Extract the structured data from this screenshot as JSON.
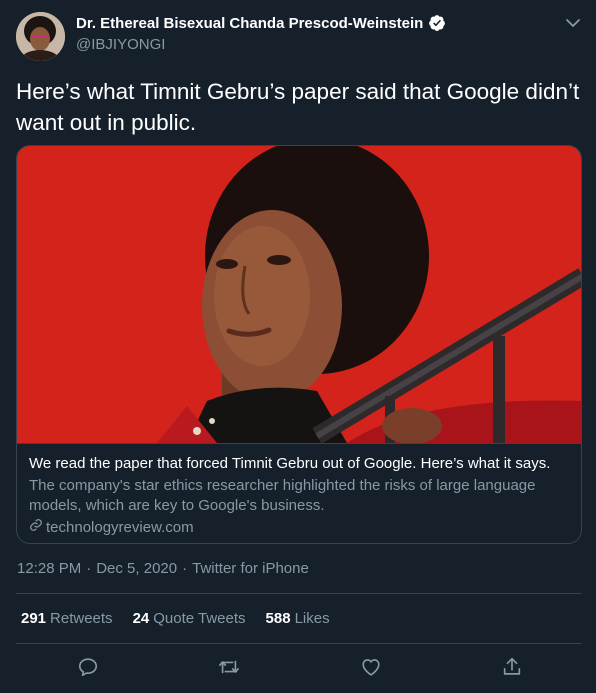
{
  "user": {
    "display_name": "Dr. Ethereal Bisexual Chanda Prescod-Weinstein",
    "handle": "@IBJIYONGI",
    "verified": true
  },
  "tweet": {
    "text": "Here’s what Timnit Gebru’s paper said that Google didn’t want out in public."
  },
  "card": {
    "title": "We read the paper that forced Timnit Gebru out of Google. Here’s what it says.",
    "description": "The company's star ethics researcher highlighted the risks of large language models, which are key to Google's business.",
    "domain": "technologyreview.com"
  },
  "meta": {
    "time": "12:28 PM",
    "separator1": "·",
    "date": "Dec 5, 2020",
    "separator2": "·",
    "source": "Twitter for iPhone"
  },
  "stats": {
    "retweets_count": "291",
    "retweets_label": "Retweets",
    "quote_count": "24",
    "quote_label": "Quote Tweets",
    "likes_count": "588",
    "likes_label": "Likes"
  },
  "icons": {
    "verified": "verified-badge-icon",
    "caret": "chevron-down-icon",
    "reply": "reply-icon",
    "retweet": "retweet-icon",
    "like": "heart-icon",
    "share": "share-icon",
    "link": "link-icon"
  },
  "colors": {
    "background": "#15202b",
    "secondary_text": "#8899a6",
    "border": "#38444d",
    "accent": "#1da1f2",
    "card_image_red": "#d9261c"
  }
}
